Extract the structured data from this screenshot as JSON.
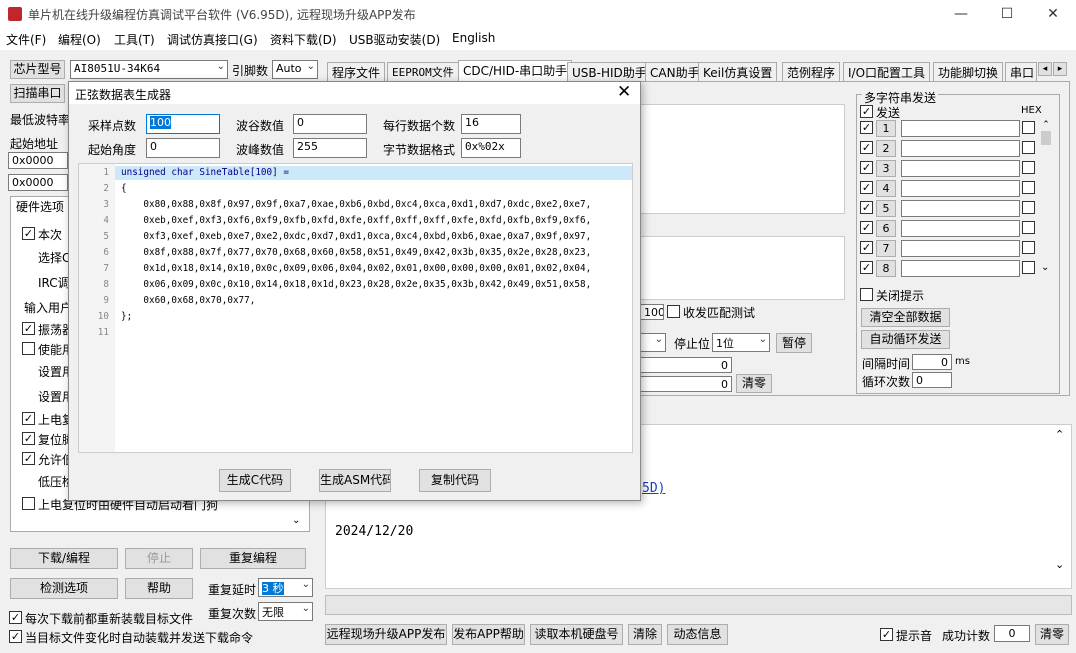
{
  "app": {
    "title": "单片机在线升级编程仿真调试平台软件 (V6.95D), 远程现场升级APP发布"
  },
  "window_controls": {
    "minimize": "—",
    "maximize": "☐",
    "close": "✕"
  },
  "menu": [
    "文件(F)",
    "编程(O)",
    "工具(T)",
    "调试仿真接口(G)",
    "资料下载(D)",
    "USB驱动安装(D)",
    "English"
  ],
  "left": {
    "chip_label": "芯片型号",
    "chip_value": "AI8051U-34K64",
    "pins_label": "引脚数",
    "pins_value": "Auto",
    "scan_button": "扫描串口",
    "min_baud_label": "最低波特率",
    "start_addr_label": "起始地址",
    "addr1": "0x0000",
    "addr2": "0x0000",
    "hw_tab": "硬件选项",
    "hw_items": [
      "本次",
      "选择C",
      "IRC调",
      "输入用户",
      "振荡器",
      "使能用",
      "设置用",
      "设置用",
      "上电复",
      "复位脚",
      "允许低",
      "低压检",
      "上电复位时由硬件自动启动看门狗"
    ],
    "download_button": "下载/编程",
    "stop_button": "停止",
    "reprogram_button": "重复编程",
    "detect_button": "检测选项",
    "help_button": "帮助",
    "repeat_delay_label": "重复延时",
    "repeat_delay_value": "3 秒",
    "repeat_count_label": "重复次数",
    "repeat_count_value": "无限",
    "reload_label": "每次下载前都重新装载目标文件",
    "auto_label": "当目标文件变化时自动装载并发送下载命令"
  },
  "tabs": [
    "程序文件",
    "EEPROM文件",
    "CDC/HID-串口助手",
    "USB-HID助手",
    "CAN助手",
    "Keil仿真设置",
    "范例程序",
    "I/O口配置工具",
    "功能脚切换",
    "串口"
  ],
  "right": {
    "multi_title": "多字符串发送",
    "send_label": "发送",
    "hex_label": "HEX",
    "rows": [
      "1",
      "2",
      "3",
      "4",
      "5",
      "6",
      "7",
      "8"
    ],
    "close_hint": "关闭提示",
    "clear_all": "清空全部数据",
    "auto_loop": "自动循环发送",
    "interval_label": "间隔时间",
    "interval_value": "0",
    "interval_unit": "ms",
    "loop_label": "循环次数",
    "loop_value": "0",
    "recv_match": "收发匹配测试",
    "recv_value": "100",
    "stop_bit_label": "停止位",
    "stop_bit_value": "1位",
    "pause_button": "暂停",
    "count1": "0",
    "count2": "0",
    "clear_button": "清零",
    "link_text": "5D)",
    "date_text": "2024/12/20"
  },
  "bottom": {
    "remote_button": "远程现场升级APP发布",
    "publish_help": "发布APP帮助",
    "read_disk": "读取本机硬盘号",
    "clear": "清除",
    "dynamic": "动态信息",
    "sound_label": "提示音",
    "success_label": "成功计数",
    "success_value": "0",
    "clear2": "清零"
  },
  "dialog": {
    "title": "正弦数据表生成器",
    "sample_label": "采样点数",
    "sample_value": "100",
    "valley_label": "波谷数值",
    "valley_value": "0",
    "per_line_label": "每行数据个数",
    "per_line_value": "16",
    "angle_label": "起始角度",
    "angle_value": "0",
    "peak_label": "波峰数值",
    "peak_value": "255",
    "format_label": "字节数据格式",
    "format_value": "0x%02x",
    "gen_c": "生成C代码",
    "gen_asm": "生成ASM代码",
    "copy": "复制代码",
    "lines": [
      "unsigned char SineTable[100] =",
      "{",
      "    0x80,0x88,0x8f,0x97,0x9f,0xa7,0xae,0xb6,0xbd,0xc4,0xca,0xd1,0xd7,0xdc,0xe2,0xe7,",
      "    0xeb,0xef,0xf3,0xf6,0xf9,0xfb,0xfd,0xfe,0xff,0xff,0xff,0xfe,0xfd,0xfb,0xf9,0xf6,",
      "    0xf3,0xef,0xeb,0xe7,0xe2,0xdc,0xd7,0xd1,0xca,0xc4,0xbd,0xb6,0xae,0xa7,0x9f,0x97,",
      "    0x8f,0x88,0x7f,0x77,0x70,0x68,0x60,0x58,0x51,0x49,0x42,0x3b,0x35,0x2e,0x28,0x23,",
      "    0x1d,0x18,0x14,0x10,0x0c,0x09,0x06,0x04,0x02,0x01,0x00,0x00,0x00,0x01,0x02,0x04,",
      "    0x06,0x09,0x0c,0x10,0x14,0x18,0x1d,0x23,0x28,0x2e,0x35,0x3b,0x42,0x49,0x51,0x58,",
      "    0x60,0x68,0x70,0x77,",
      "};",
      ""
    ],
    "line_numbers": [
      "1",
      "2",
      "3",
      "4",
      "5",
      "6",
      "7",
      "8",
      "9",
      "10",
      "11"
    ]
  }
}
